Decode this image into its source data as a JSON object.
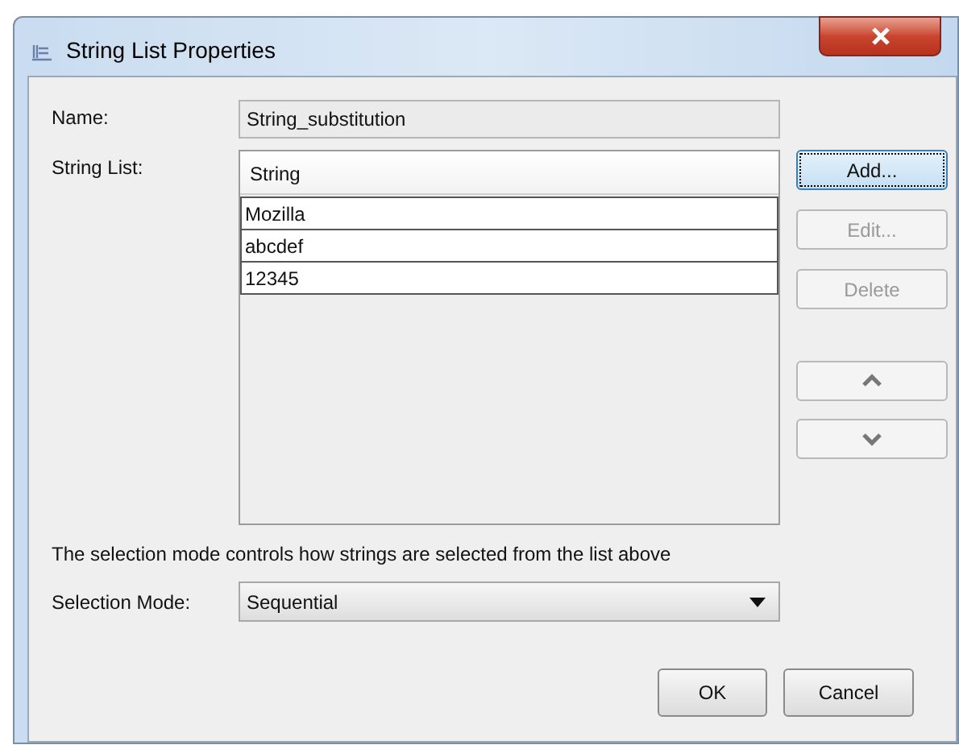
{
  "window": {
    "title": "String List Properties"
  },
  "name": {
    "label": "Name:",
    "value": "String_substitution"
  },
  "string_list": {
    "label": "String List:",
    "column": "String",
    "rows": [
      {
        "text": "Mozilla"
      },
      {
        "text": "abcdef"
      },
      {
        "text": "12345"
      }
    ]
  },
  "side_buttons": [
    {
      "kind": "text",
      "label": "Add...",
      "disabled": false,
      "focused": true
    },
    {
      "kind": "text",
      "label": "Edit...",
      "disabled": true,
      "focused": false
    },
    {
      "kind": "text",
      "label": "Delete",
      "disabled": true,
      "focused": false
    },
    {
      "kind": "up",
      "disabled": false,
      "focused": false
    },
    {
      "kind": "down",
      "disabled": false,
      "focused": false
    }
  ],
  "hint": "The selection mode controls how strings are selected from the list above",
  "selection_mode": {
    "label": "Selection Mode:",
    "value": "Sequential"
  },
  "buttons": [
    "OK",
    "Cancel"
  ]
}
